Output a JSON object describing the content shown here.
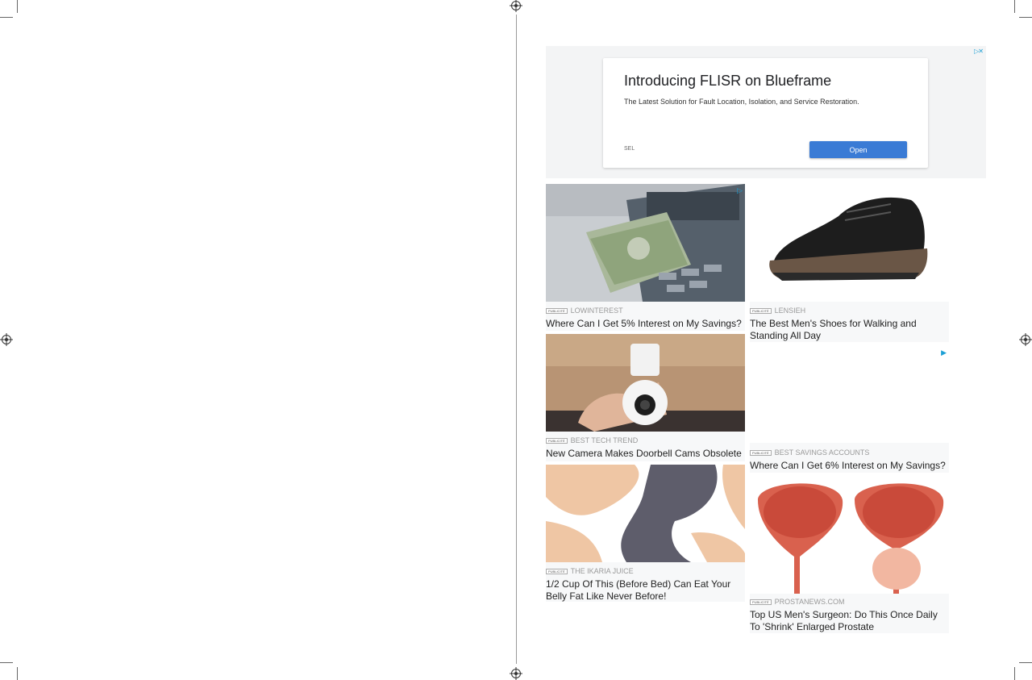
{
  "banner_ad": {
    "title": "Introducing FLISR on Blueframe",
    "subtitle": "The Latest Solution for Fault Location, Isolation, and Service Restoration.",
    "advertiser": "SEL",
    "button_label": "Open",
    "adchoices_icon": "adchoices-icon"
  },
  "ads": [
    {
      "badge": "PUBLICITÉ",
      "source": "LOWINTEREST",
      "headline": "Where Can I Get 5% Interest on My Savings?",
      "image": "atm-cash-image"
    },
    {
      "badge": "PUBLICITÉ",
      "source": "LENSIEH",
      "headline": "The Best Men's Shoes for Walking and Standing All Day",
      "image": "black-shoe-image"
    },
    {
      "badge": "PUBLICITÉ",
      "source": "BEST TECH TREND",
      "headline": "New Camera Makes Doorbell Cams Obsolete",
      "image": "bulb-camera-image"
    },
    {
      "badge": "PUBLICITÉ",
      "source": "BEST SAVINGS ACCOUNTS",
      "headline": "Where Can I Get 6% Interest on My Savings?",
      "image": "blank-image"
    },
    {
      "badge": "PUBLICITÉ",
      "source": "THE IKARIA JUICE",
      "headline": "1/2 Cup Of This (Before Bed) Can Eat Your Belly Fat Like Never Before!",
      "image": "abstract-shapes-image"
    },
    {
      "badge": "PUBLICITÉ",
      "source": "PROSTANEWS.COM",
      "headline": "Top US Men's Surgeon: Do This Once Daily To 'Shrink' Enlarged Prostate",
      "image": "prostate-illustration-image"
    }
  ],
  "colors": {
    "button": "#3a7bd5",
    "adchoices": "#1ea0d5"
  }
}
